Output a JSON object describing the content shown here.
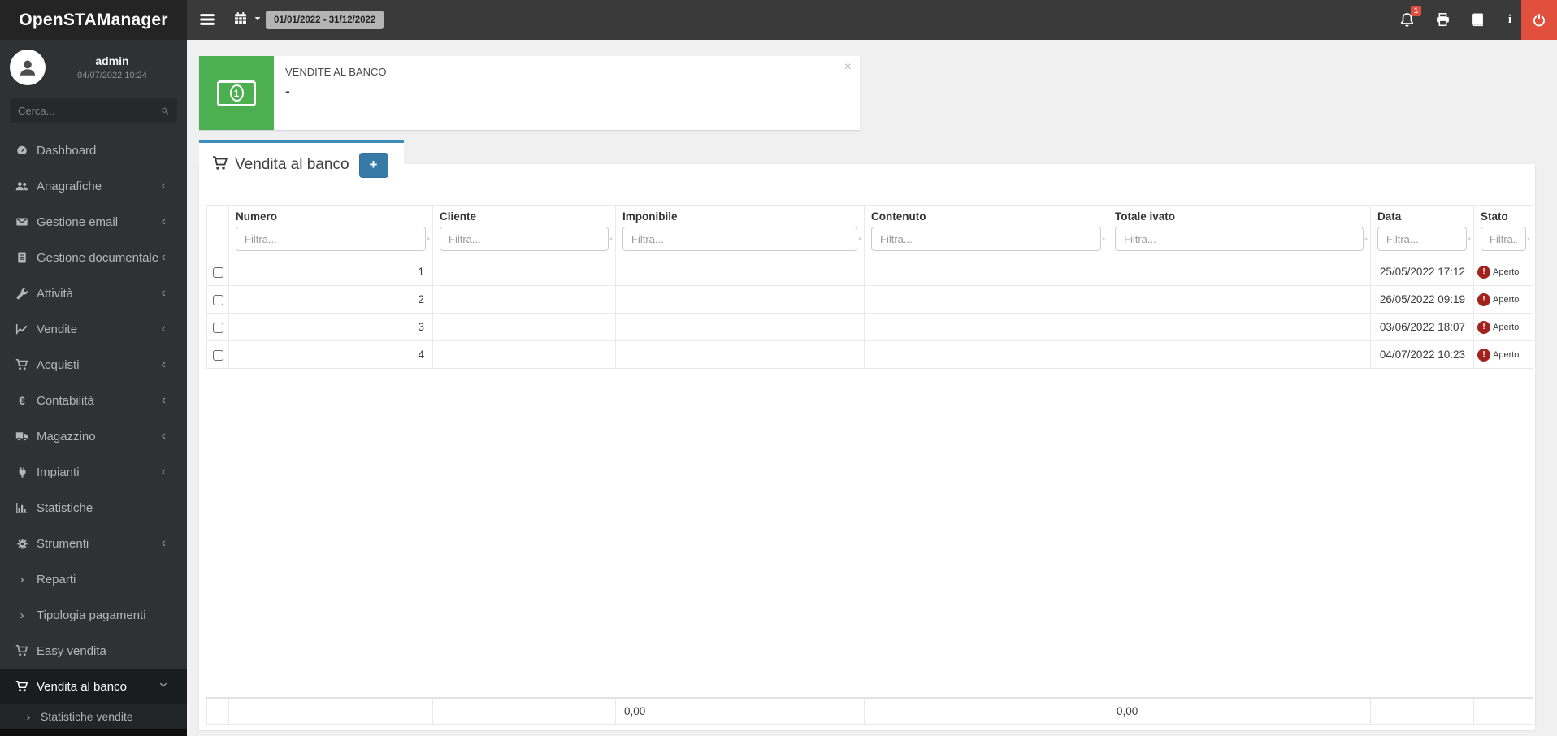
{
  "app": {
    "name": "OpenSTAManager",
    "date_range": "01/01/2022 - 31/12/2022",
    "notification_count": "1"
  },
  "colors": {
    "accent_blue": "#3c8dbc",
    "add_button_blue": "#387aa7",
    "infobox_green": "#4caf50",
    "alert_red": "#e0503c",
    "status_red": "#a2231d"
  },
  "icons": {
    "info": "i",
    "euro": "€",
    "plus": "+",
    "close": "×",
    "sort_asc": "▲",
    "exclamation": "!",
    "chevron_left": "‹",
    "chevron_right": "›",
    "money_digit": "1"
  },
  "sidebar": {
    "user": {
      "name": "admin",
      "datetime": "04/07/2022 10:24"
    },
    "search_placeholder": "Cerca...",
    "items": [
      {
        "label": "Dashboard",
        "icon": "tachometer-icon"
      },
      {
        "label": "Anagrafiche",
        "icon": "users-icon"
      },
      {
        "label": "Gestione email",
        "icon": "envelope-icon"
      },
      {
        "label": "Gestione documentale",
        "icon": "document-icon"
      },
      {
        "label": "Attività",
        "icon": "wrench-icon"
      },
      {
        "label": "Vendite",
        "icon": "line-chart-icon"
      },
      {
        "label": "Acquisti",
        "icon": "cart-icon"
      },
      {
        "label": "Contabilità",
        "icon": "euro-icon"
      },
      {
        "label": "Magazzino",
        "icon": "truck-icon"
      },
      {
        "label": "Impianti",
        "icon": "plug-icon"
      },
      {
        "label": "Statistiche",
        "icon": "bar-chart-icon"
      },
      {
        "label": "Strumenti",
        "icon": "gear-icon"
      },
      {
        "label": "Reparti",
        "icon": "chevron-right-icon"
      },
      {
        "label": "Tipologia pagamenti",
        "icon": "chevron-right-icon"
      },
      {
        "label": "Easy vendita",
        "icon": "cart-icon"
      },
      {
        "label": "Vendita al banco",
        "icon": "cart-icon",
        "active": true,
        "expanded": true
      },
      {
        "label": "Statistiche vendite",
        "icon": "chevron-right-icon",
        "submenu": true
      }
    ]
  },
  "infobox": {
    "label": "VENDITE AL BANCO",
    "value": "-"
  },
  "page": {
    "tab_title": "Vendita al banco"
  },
  "table": {
    "filter_placeholder": "Filtra...",
    "columns": [
      "Numero",
      "Cliente",
      "Imponibile",
      "Contenuto",
      "Totale ivato",
      "Data",
      "Stato"
    ],
    "rows": [
      {
        "numero": "1",
        "cliente": "",
        "imponibile": "",
        "contenuto": "",
        "totale_ivato": "",
        "data": "25/05/2022 17:12",
        "stato": "Aperto"
      },
      {
        "numero": "2",
        "cliente": "",
        "imponibile": "",
        "contenuto": "",
        "totale_ivato": "",
        "data": "26/05/2022 09:19",
        "stato": "Aperto"
      },
      {
        "numero": "3",
        "cliente": "",
        "imponibile": "",
        "contenuto": "",
        "totale_ivato": "",
        "data": "03/06/2022 18:07",
        "stato": "Aperto"
      },
      {
        "numero": "4",
        "cliente": "",
        "imponibile": "",
        "contenuto": "",
        "totale_ivato": "",
        "data": "04/07/2022 10:23",
        "stato": "Aperto"
      }
    ],
    "footer": {
      "imponibile_total": "0,00",
      "totale_ivato_total": "0,00"
    }
  }
}
